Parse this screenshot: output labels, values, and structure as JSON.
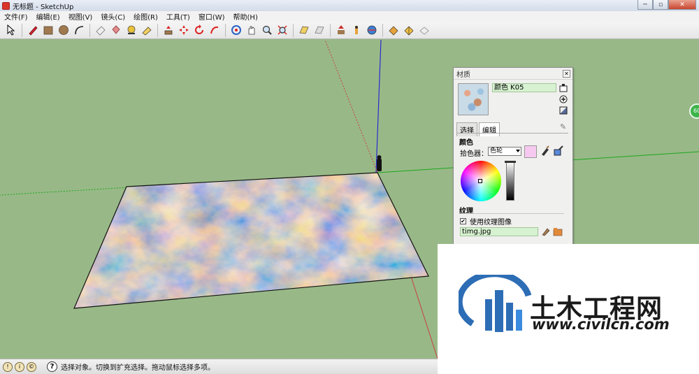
{
  "window": {
    "title": "无标题 - SketchUp"
  },
  "menu": [
    "文件(F)",
    "编辑(E)",
    "视图(V)",
    "镜头(C)",
    "绘图(R)",
    "工具(T)",
    "窗口(W)",
    "帮助(H)"
  ],
  "toolbar_icons": [
    "select-icon",
    "pencil-icon",
    "rectangle-icon",
    "circle-icon",
    "arc-icon",
    "eraser-icon",
    "paint-bucket-icon",
    "tape-measure-icon",
    "dimension-icon",
    "push-pull-icon",
    "move-icon",
    "rotate-icon",
    "follow-me-icon",
    "orbit-icon",
    "pan-icon",
    "zoom-icon",
    "zoom-extents-icon",
    "section-plane-icon",
    "position-camera-icon",
    "walk-icon",
    "look-around-icon",
    "get-models-icon",
    "share-model-icon",
    "components-icon",
    "layers-icon"
  ],
  "materials_panel": {
    "title": "材质",
    "material_name": "颜色 K05",
    "tabs": [
      "选择",
      "编辑"
    ],
    "color_heading": "颜色",
    "picker_label": "拾色器：",
    "picker_value": "色轮",
    "preview_color": "#f6c9f0",
    "texture_heading": "纹理",
    "use_texture_label": "使用纹理图像",
    "texture_file": "timg.jpg"
  },
  "statusbar": {
    "text": "选择对象。切换到扩充选择。拖动鼠标选择多项。"
  },
  "watermark": {
    "name": "土木工程网",
    "url": "www.civilcn.com"
  },
  "badge": {
    "text": "60"
  }
}
